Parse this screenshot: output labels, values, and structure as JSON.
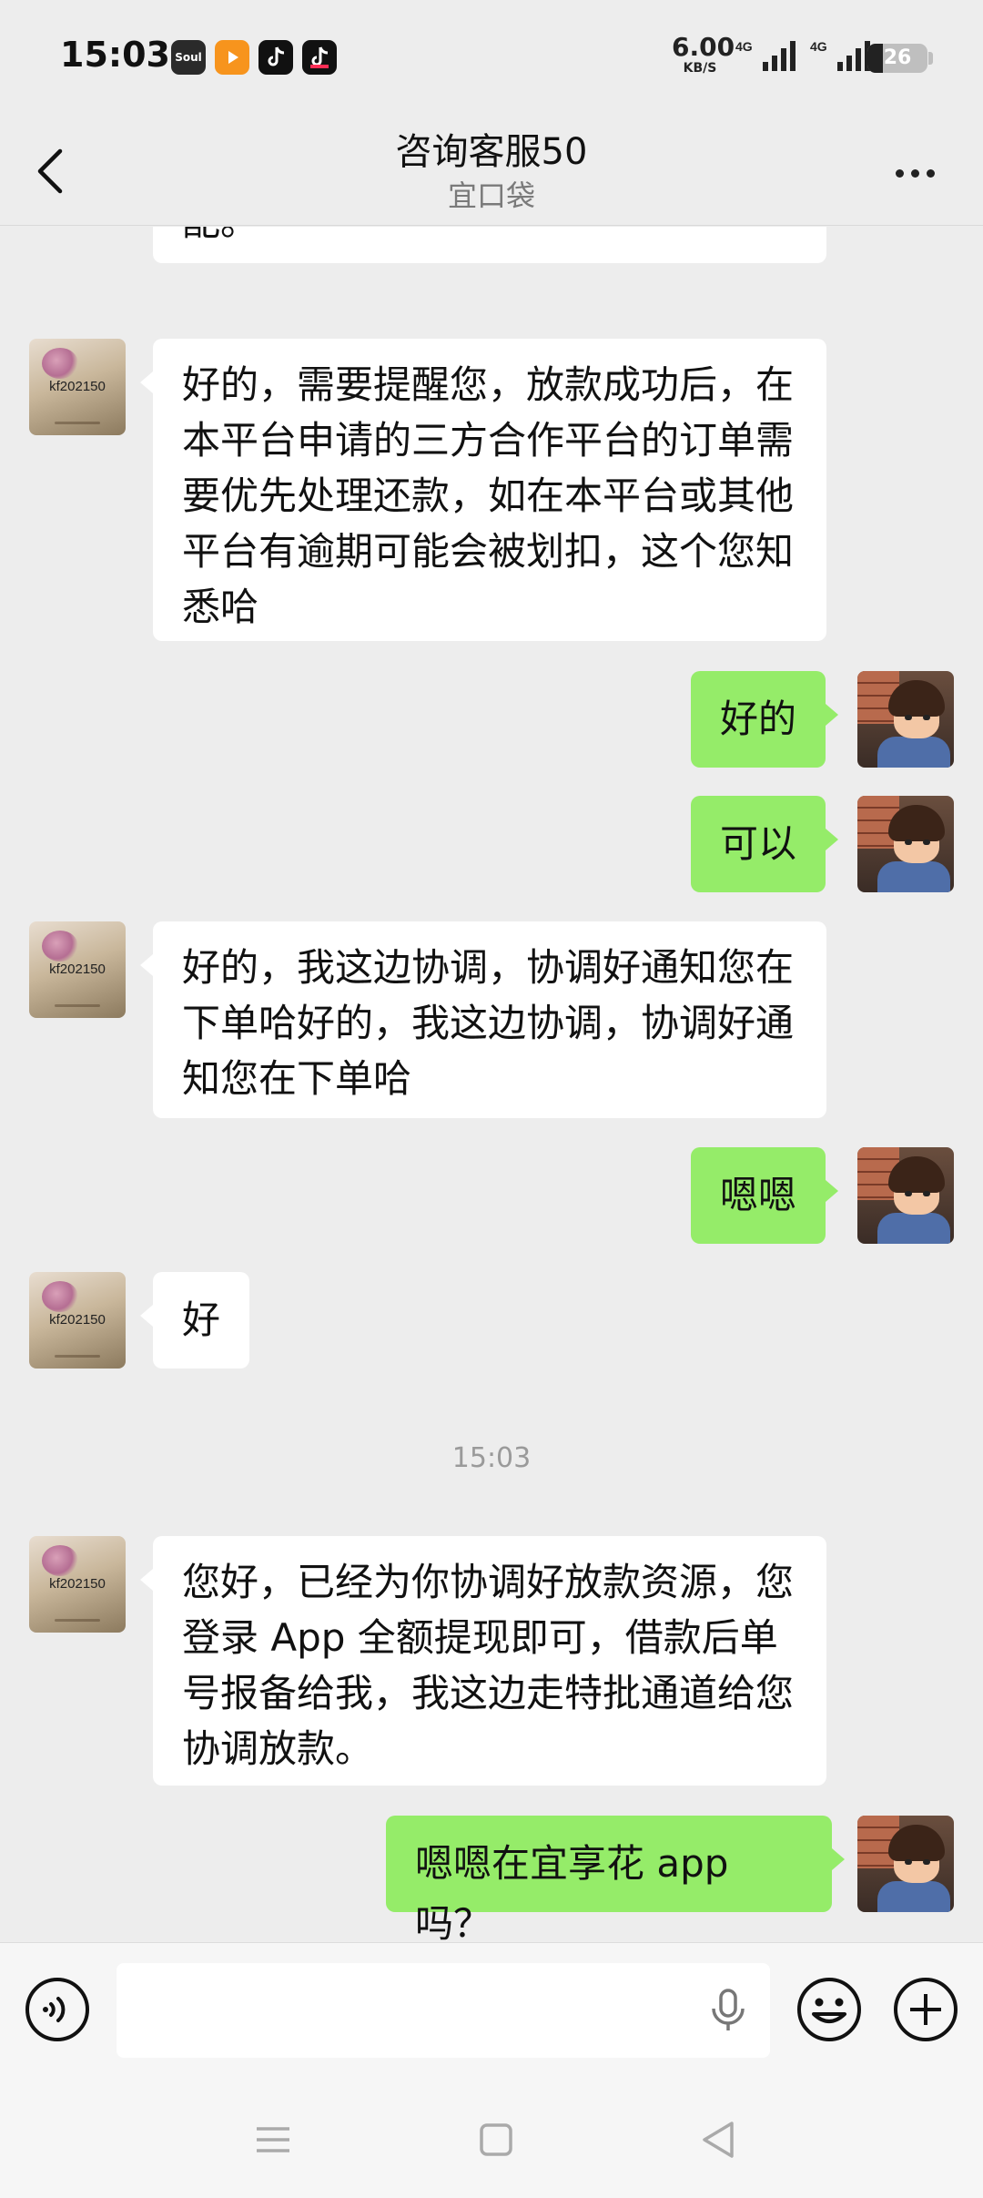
{
  "status_bar": {
    "time": "15:03",
    "app_icons": [
      "Soul",
      "video-app-icon",
      "tiktok-icon",
      "tiktok-lite-icon"
    ],
    "soul_label": "Soul",
    "net_speed_value": "6.00",
    "net_speed_unit": "KB/S",
    "signal1_label": "4G",
    "signal2_label": "4G",
    "battery_level": "26",
    "battery_fraction": 0.26
  },
  "header": {
    "title": "咨询客服50",
    "subtitle": "宜口袋",
    "back_icon": "chevron-left-icon",
    "more_icon": "more-horizontal-icon"
  },
  "chat": {
    "avatar_cs_label": "kf202150",
    "messages": [
      {
        "side": "in",
        "text": "配。"
      },
      {
        "side": "in",
        "text": "好的，需要提醒您，放款成功后，在本平台申请的三方合作平台的订单需要优先处理还款，如在本平台或其他平台有逾期可能会被划扣，这个您知悉哈"
      },
      {
        "side": "out",
        "text": "好的"
      },
      {
        "side": "out",
        "text": "可以"
      },
      {
        "side": "in",
        "text": "好的，我这边协调，协调好通知您在下单哈好的，我这边协调，协调好通知您在下单哈"
      },
      {
        "side": "out",
        "text": "嗯嗯"
      },
      {
        "side": "in",
        "text": "好"
      },
      {
        "side": "in",
        "text": "您好，已经为你协调好放款资源，您登录 App 全额提现即可，借款后单号报备给我，我这边走特批通道给您协调放款。"
      },
      {
        "side": "out",
        "text": "嗯嗯在宜享花 app 吗？"
      }
    ],
    "timestamp": "15:03"
  },
  "input_bar": {
    "voice_icon": "voice-mode-icon",
    "input_value": "",
    "mic_icon": "microphone-icon",
    "emoji_icon": "emoji-icon",
    "plus_icon": "plus-circle-icon"
  },
  "nav_bar": {
    "menu_icon": "nav-menu-icon",
    "home_icon": "nav-home-icon",
    "back_icon": "nav-back-icon"
  },
  "colors": {
    "background": "#ededed",
    "incoming_bubble": "#ffffff",
    "outgoing_bubble": "#95ec69",
    "subtitle": "#7a7a7a"
  }
}
